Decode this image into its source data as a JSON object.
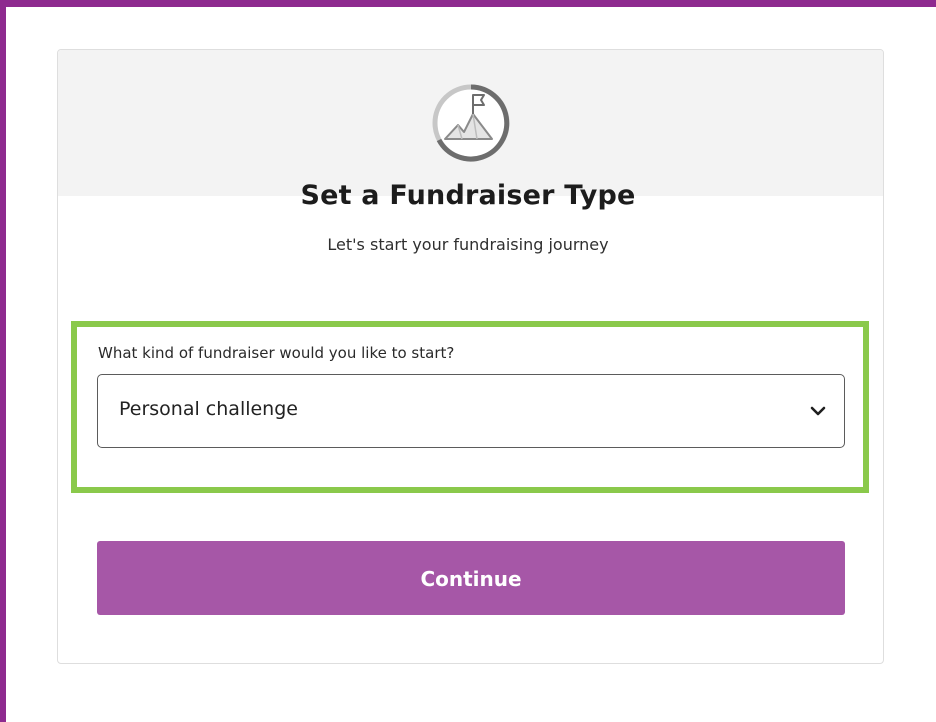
{
  "header": {
    "icon": "mountain-flag-icon"
  },
  "form": {
    "title": "Set a Fundraiser Type",
    "subtitle": "Let's start your fundraising journey",
    "field_label": "What kind of fundraiser would you like to start?",
    "selected_value": "Personal challenge",
    "continue_label": "Continue"
  },
  "colors": {
    "frame": "#8e2a8f",
    "button": "#a657a7",
    "highlight": "#8ac94b"
  }
}
